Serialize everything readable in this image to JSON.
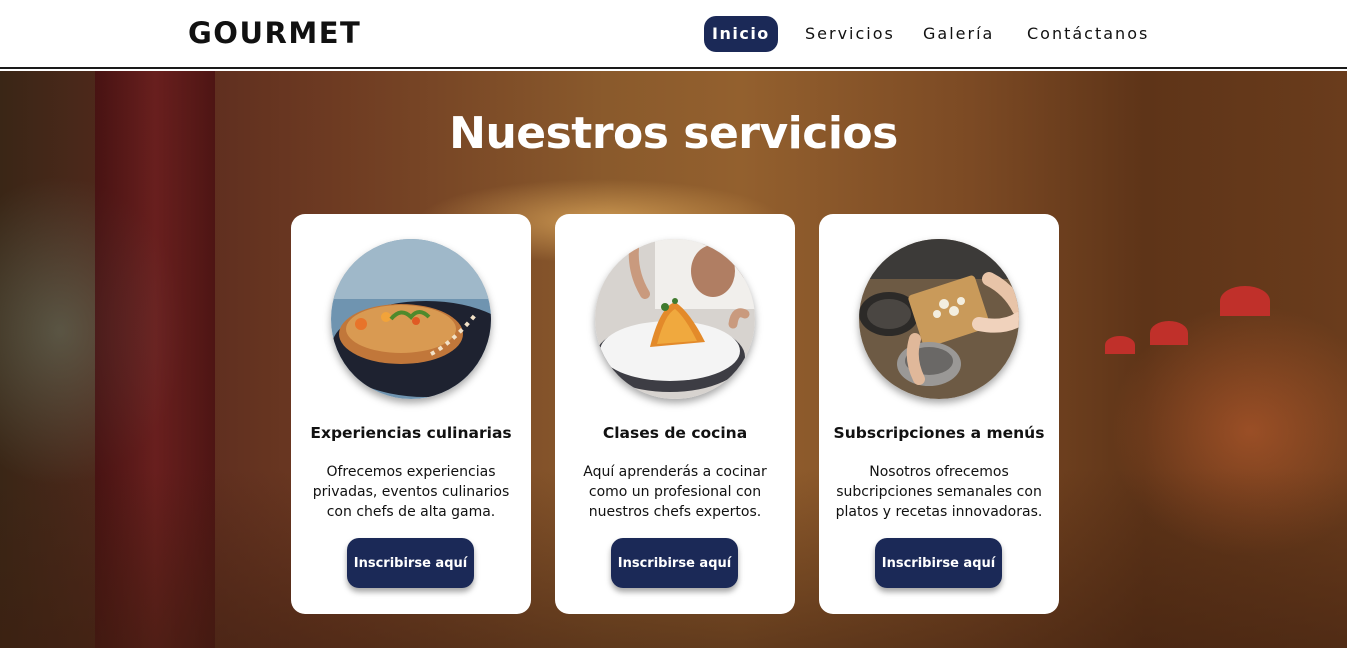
{
  "header": {
    "logo": "GOURMET",
    "nav": [
      {
        "label": "Inicio",
        "active": true
      },
      {
        "label": "Servicios",
        "active": false
      },
      {
        "label": "Galería",
        "active": false
      },
      {
        "label": "Contáctanos",
        "active": false
      }
    ]
  },
  "hero": {
    "title": "Nuestros servicios"
  },
  "cards": [
    {
      "image": "gourmet-plated-dish-photo",
      "title": "Experiencias culinarias",
      "description": "Ofrecemos experiencias privadas, eventos culinarios con chefs de alta gama.",
      "button": "Inscribirse aquí"
    },
    {
      "image": "chef-plating-dish-photo",
      "title": "Clases de cocina",
      "description": "Aquí aprenderás a cocinar como un profesional con nuestros chefs expertos.",
      "button": "Inscribirse aquí"
    },
    {
      "image": "hands-cutting-ingredients-photo",
      "title": "Subscripciones a menús",
      "description": "Nosotros ofrecemos subcripciones semanales con platos y recetas innovadoras.",
      "button": "Inscribirse aquí"
    }
  ],
  "colors": {
    "accent": "#1b2957",
    "card_bg": "#ffffff",
    "title_text": "#ffffff"
  }
}
